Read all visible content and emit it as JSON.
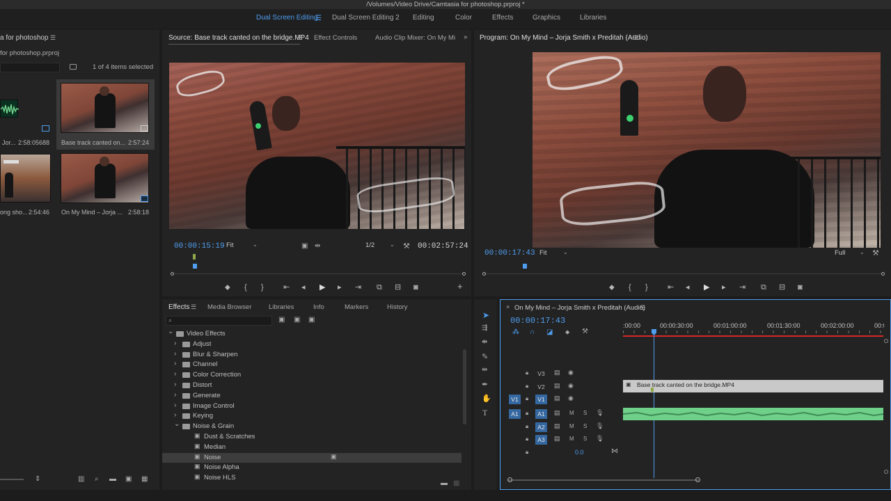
{
  "title": "/Volumes/Video Drive/Camtasia for photoshop.prproj *",
  "workspaces": [
    "Dual Screen Editing",
    "Dual Screen Editing 2",
    "Editing",
    "Color",
    "Effects",
    "Graphics",
    "Libraries"
  ],
  "project": {
    "title": "a for photoshop",
    "file": "for photoshop.prproj",
    "selection": "1 of 4 items selected",
    "items": [
      {
        "name": "Jor...",
        "duration": "2:58:05688"
      },
      {
        "name": "Base track canted on...",
        "duration": "2:57:24"
      },
      {
        "name": "ong sho...",
        "duration": "2:54:46"
      },
      {
        "name": "On My Mind – Jorja ...",
        "duration": "2:58:18"
      }
    ]
  },
  "source": {
    "tab": "Source: Base track canted on the bridge.MP4",
    "tabs2": [
      "Effect Controls",
      "Audio Clip Mixer: On My Mi"
    ],
    "timecode": "00:00:15:19",
    "fit": "Fit",
    "resolution": "1/2",
    "duration": "00:02:57:24"
  },
  "program": {
    "tab": "Program: On My Mind – Jorja Smith x Preditah (Audio)",
    "timecode": "00:00:17:43",
    "fit": "Fit",
    "resolution": "Full"
  },
  "effects_panel": {
    "tabs": [
      "Effects",
      "Media Browser",
      "Libraries",
      "Info",
      "Markers",
      "History"
    ],
    "search_placeholder": "",
    "tree": [
      {
        "label": "Video Effects",
        "level": 0,
        "expanded": true
      },
      {
        "label": "Adjust",
        "level": 1
      },
      {
        "label": "Blur & Sharpen",
        "level": 1
      },
      {
        "label": "Channel",
        "level": 1
      },
      {
        "label": "Color Correction",
        "level": 1
      },
      {
        "label": "Distort",
        "level": 1
      },
      {
        "label": "Generate",
        "level": 1
      },
      {
        "label": "Image Control",
        "level": 1
      },
      {
        "label": "Keying",
        "level": 1
      },
      {
        "label": "Noise & Grain",
        "level": 1,
        "expanded": true
      },
      {
        "label": "Dust & Scratches",
        "level": 2
      },
      {
        "label": "Median",
        "level": 2
      },
      {
        "label": "Noise",
        "level": 2,
        "selected": true
      },
      {
        "label": "Noise Alpha",
        "level": 2
      },
      {
        "label": "Noise HLS",
        "level": 2
      }
    ]
  },
  "timeline": {
    "title": "On My Mind – Jorja Smith x Preditah (Audio)",
    "timecode": "00:00:17:43",
    "ruler": [
      ":00:00",
      "00:00:30:00",
      "00:01:00:00",
      "00:01:30:00",
      "00:02:00:00",
      "00:0"
    ],
    "video_tracks": [
      "V3",
      "V2",
      "V1"
    ],
    "audio_tracks": [
      "A1",
      "A2",
      "A3"
    ],
    "clip_name": "Base track canted on the bridge.MP4",
    "master_volume": "0.0",
    "m_label": "M",
    "s_label": "S",
    "src_v": "V1",
    "src_a": "A1"
  },
  "colors": {
    "accent": "#4f9ef0",
    "audio_clip": "#6fd08a",
    "video_clip": "#c9c9c9"
  }
}
